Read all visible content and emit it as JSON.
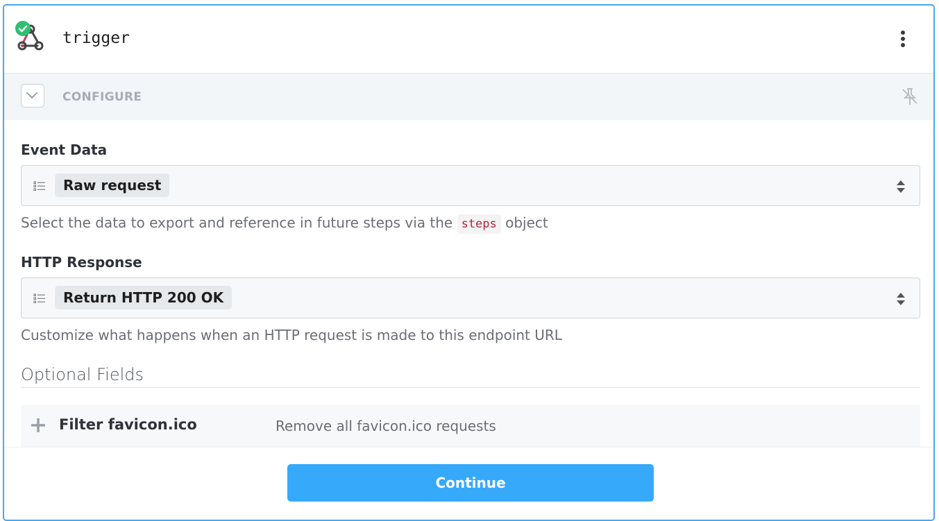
{
  "header": {
    "title": "trigger",
    "icon": "webhook-icon",
    "status": "success-check-icon"
  },
  "configure": {
    "label": "CONFIGURE"
  },
  "event_data": {
    "label": "Event Data",
    "selected": "Raw request",
    "help_before": "Select the data to export and reference in future steps via the",
    "help_code": "steps",
    "help_after": "object"
  },
  "http_response": {
    "label": "HTTP Response",
    "selected": "Return HTTP 200 OK",
    "help": "Customize what happens when an HTTP request is made to this endpoint URL"
  },
  "optional": {
    "title": "Optional Fields",
    "items": [
      {
        "name": "Filter favicon.ico",
        "description": "Remove all favicon.ico requests"
      }
    ]
  },
  "footer": {
    "continue_label": "Continue"
  },
  "colors": {
    "accent": "#37a9fb",
    "frame_border": "#46a8f2",
    "success": "#2fbf71",
    "code": "#b0243c"
  }
}
